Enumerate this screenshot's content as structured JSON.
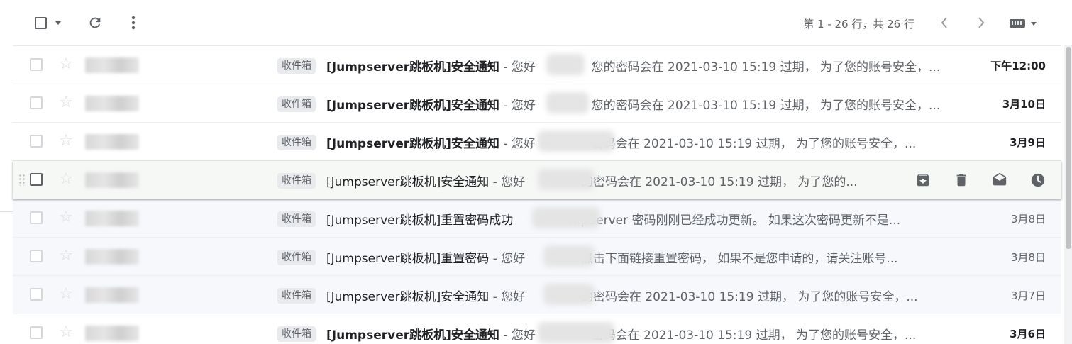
{
  "toolbar": {
    "pagination": "第 1 - 26 行，共 26 行"
  },
  "icons": {
    "select_all": "checkbox-icon",
    "refresh": "refresh-icon",
    "more": "more-vert-icon",
    "prev": "chevron-left-icon",
    "next": "chevron-right-icon",
    "keyboard": "keyboard-icon",
    "archive": "archive-icon",
    "delete": "delete-icon",
    "mark_read": "mark-as-read-icon",
    "snooze": "snooze-icon"
  },
  "emails": [
    {
      "label": "收件箱",
      "subject": "[Jumpserver跳板机]安全通知",
      "snippet": " - 您好 　　　　 您的密码会在 2021-03-10 15:19 过期， 为了您的账号安全，...",
      "date": "下午12:00",
      "unread": true
    },
    {
      "label": "收件箱",
      "subject": "[Jumpserver跳板机]安全通知",
      "snippet": " - 您好 　　　　 您的密码会在 2021-03-10 15:19 过期， 为了您的账号安全，...",
      "date": "3月10日",
      "unread": true
    },
    {
      "label": "收件箱",
      "subject": "[Jumpserver跳板机]安全通知",
      "snippet": " - 您好 　　　　 密码会在 2021-03-10 15:19 过期， 为了您的账号安全，...",
      "date": "3月9日",
      "unread": true
    },
    {
      "label": "收件箱",
      "subject": "[Jumpserver跳板机]安全通知",
      "snippet": " - 您好 　　　　 的密码会在 2021-03-10 15:19 过期， 为了您的...",
      "date": "",
      "unread": false,
      "hover": true
    },
    {
      "label": "收件箱",
      "subject": "[Jumpserver跳板机]重置密码成功",
      "snippet": " 　　　　 mpServer 密码刚刚已经成功更新。 如果这次密码更新不是...",
      "date": "3月8日",
      "unread": false
    },
    {
      "label": "收件箱",
      "subject": "[Jumpserver跳板机]重置密码",
      "snippet": " - 您好 　　　　 点击下面链接重置密码， 如果不是您申请的，请关注账号...",
      "date": "3月8日",
      "unread": false
    },
    {
      "label": "收件箱",
      "subject": "[Jumpserver跳板机]安全通知",
      "snippet": " - 您好 　　　　 的密码会在 2021-03-10 15:19 过期， 为了您的账号安全，...",
      "date": "3月7日",
      "unread": false
    },
    {
      "label": "收件箱",
      "subject": "[Jumpserver跳板机]安全通知",
      "snippet": " - 您好 　　　　 密码会在 2021-03-10 15:19 过期， 为了您的账号安全，...",
      "date": "3月6日",
      "unread": true
    }
  ]
}
